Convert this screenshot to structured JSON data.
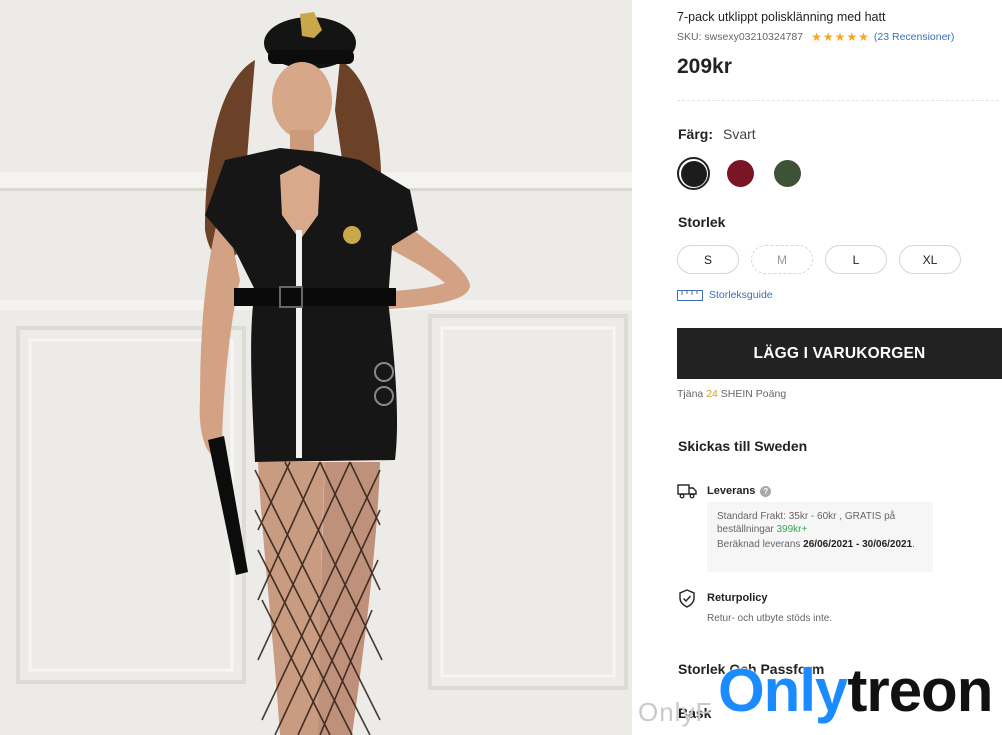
{
  "product": {
    "title": "7-pack utklippt polisklänning med hatt",
    "sku": "SKU: swsexy03210324787",
    "rating_stars": "★★★★★",
    "rating_value": 4.5,
    "reviews": "(23 Recensioner)",
    "price": "209kr"
  },
  "color": {
    "label": "Färg:",
    "selected": "Svart",
    "swatches": [
      {
        "name": "Svart",
        "hex": "#1c1c1c",
        "selected": true
      },
      {
        "name": "Vinröd",
        "hex": "#7a1524",
        "selected": false
      },
      {
        "name": "Grön",
        "hex": "#3e5235",
        "selected": false
      }
    ]
  },
  "size": {
    "label": "Storlek",
    "options": [
      "S",
      "M",
      "L",
      "XL"
    ],
    "guide": "Storleksguide"
  },
  "cart": {
    "button": "LÄGG I VARUKORGEN",
    "points_prefix": "Tjäna",
    "points_value": "24",
    "points_suffix": "SHEIN Poäng"
  },
  "shipping": {
    "title": "Skickas till Sweden",
    "delivery_label": "Leverans",
    "help": "?",
    "standard_line": "Standard Frakt: 35kr - 60kr , GRATIS på beställningar",
    "threshold": "399kr+",
    "estimate_label": "Beräknad leverans",
    "estimate_dates": "26/06/2021 - 30/06/2021",
    "return_label": "Returpolicy",
    "return_text": "Retur- och utbyte stöds inte."
  },
  "sections": {
    "fit": "Storlek Och Passform",
    "basic": "Bask"
  },
  "watermark": {
    "small": "OnlyF",
    "big_a": "Only",
    "big_b": "treon"
  },
  "colors": {
    "button_bg": "#222222",
    "link": "#3d6fb6",
    "star": "#f5a623",
    "points": "#c9a227",
    "free_green": "#3aa655"
  }
}
